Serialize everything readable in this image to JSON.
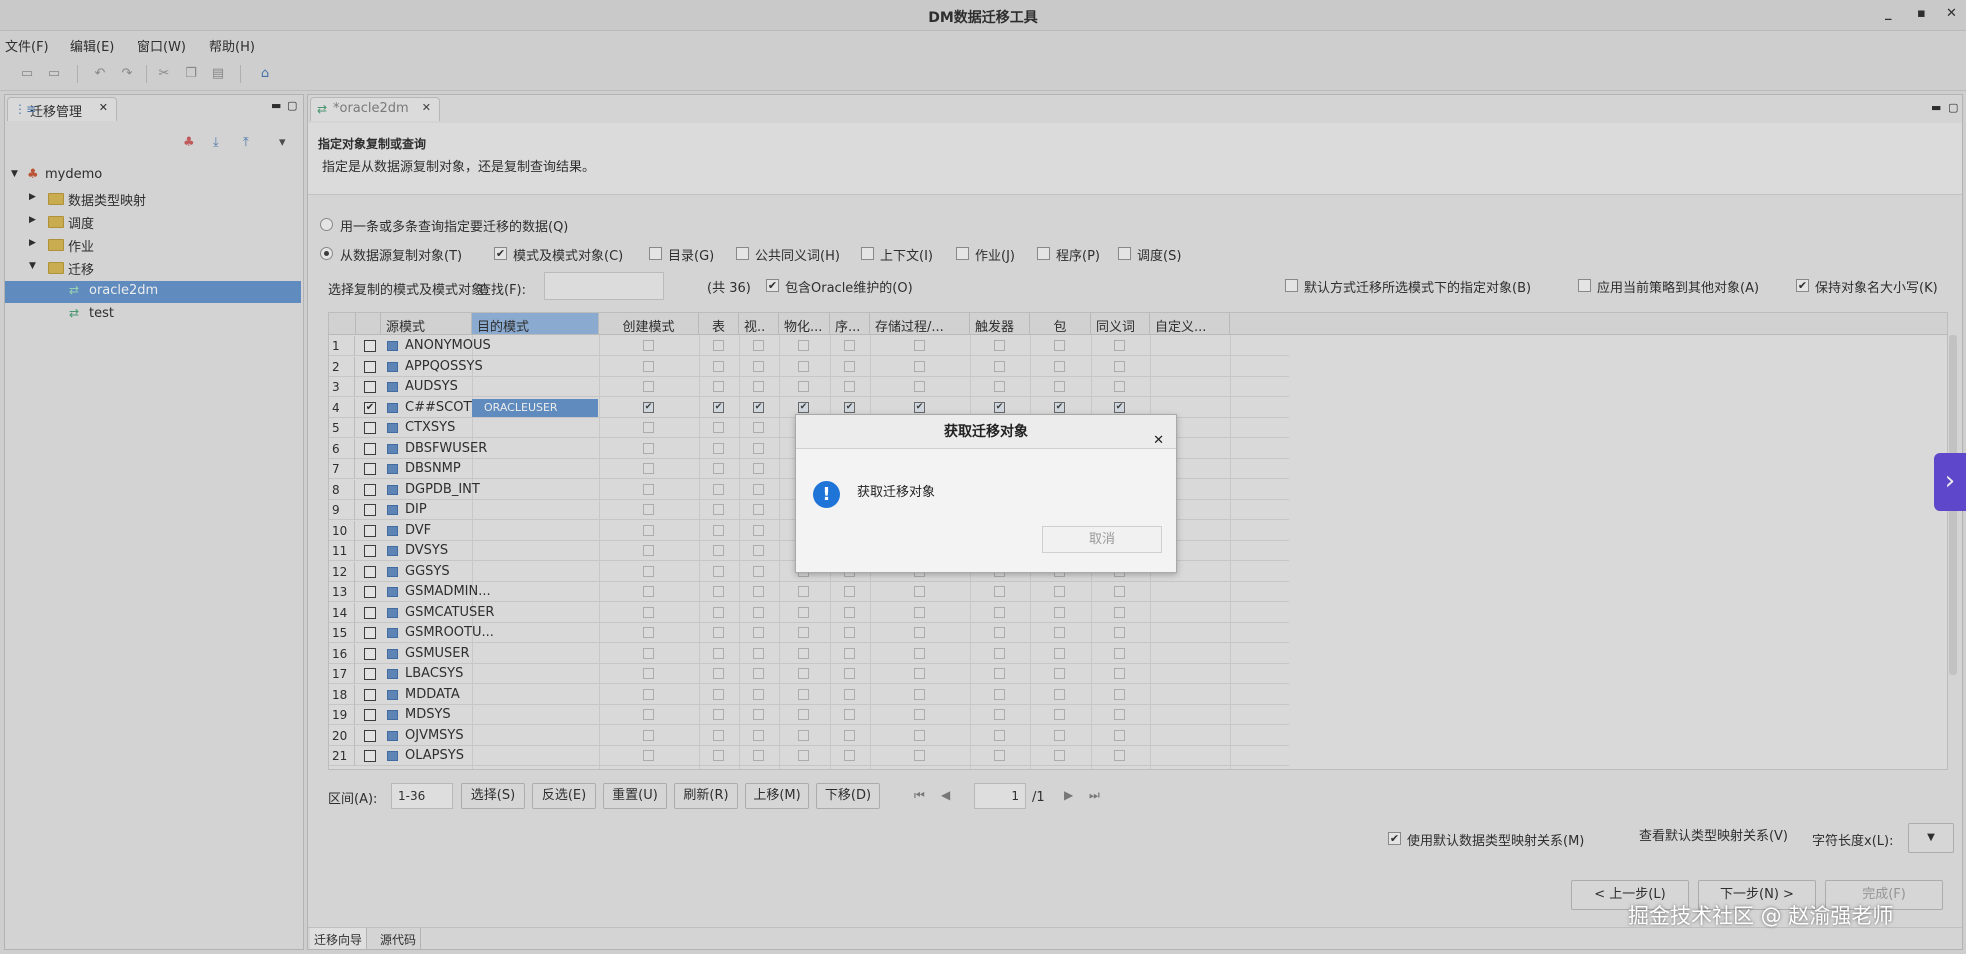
{
  "window": {
    "title": "DM数据迁移工具",
    "minimize": "▪",
    "maximize": "▪",
    "close": "✕"
  },
  "menu": [
    "文件(F)",
    "编辑(E)",
    "窗口(W)",
    "帮助(H)"
  ],
  "toolbar_icons": [
    "save-icon",
    "save-all-icon",
    "undo-icon",
    "redo-icon",
    "cut-icon",
    "copy-icon",
    "paste-icon",
    "home-icon"
  ],
  "left_panel": {
    "tab": "迁移管理",
    "tree": {
      "root": "mydemo",
      "children": [
        "数据类型映射",
        "调度",
        "作业",
        "迁移"
      ],
      "migrations": [
        "oracle2dm",
        "test"
      ],
      "selected": "oracle2dm"
    }
  },
  "editor": {
    "tab": "*oracle2dm",
    "heading": "指定对象复制或查询",
    "subheading": "指定是从数据源复制对象，还是复制查询结果。",
    "option_query": "用一条或多条查询指定要迁移的数据(Q)",
    "option_copy": "从数据源复制对象(T)",
    "copy_checks": [
      {
        "label": "模式及模式对象(C)",
        "checked": true
      },
      {
        "label": "目录(G)",
        "checked": false
      },
      {
        "label": "公共同义词(H)",
        "checked": false
      },
      {
        "label": "上下文(I)",
        "checked": false
      },
      {
        "label": "作业(J)",
        "checked": false
      },
      {
        "label": "程序(P)",
        "checked": false
      },
      {
        "label": "调度(S)",
        "checked": false
      }
    ],
    "select_label": "选择复制的模式及模式对象:",
    "search_label": "查找(F):",
    "count_text": "(共 36)",
    "include_oracle": "包含Oracle维护的(O)",
    "default_migrate": "默认方式迁移所选模式下的指定对象(B)",
    "apply_policy": "应用当前策略到其他对象(A)",
    "keep_case": "保持对象名大小写(K)",
    "columns": [
      "源模式",
      "目的模式",
      "创建模式",
      "表",
      "视..",
      "物化...",
      "序...",
      "存储过程/...",
      "触发器",
      "包",
      "同义词",
      "自定义..."
    ],
    "rows": [
      {
        "n": "1",
        "name": "ANONYMOUS"
      },
      {
        "n": "2",
        "name": "APPQOSSYS"
      },
      {
        "n": "3",
        "name": "AUDSYS"
      },
      {
        "n": "4",
        "name": "C##SCOTT",
        "checked": true,
        "dest": "ORACLEUSER"
      },
      {
        "n": "5",
        "name": "CTXSYS"
      },
      {
        "n": "6",
        "name": "DBSFWUSER"
      },
      {
        "n": "7",
        "name": "DBSNMP"
      },
      {
        "n": "8",
        "name": "DGPDB_INT"
      },
      {
        "n": "9",
        "name": "DIP"
      },
      {
        "n": "10",
        "name": "DVF"
      },
      {
        "n": "11",
        "name": "DVSYS"
      },
      {
        "n": "12",
        "name": "GGSYS"
      },
      {
        "n": "13",
        "name": "GSMADMIN..."
      },
      {
        "n": "14",
        "name": "GSMCATUSER"
      },
      {
        "n": "15",
        "name": "GSMROOTU..."
      },
      {
        "n": "16",
        "name": "GSMUSER"
      },
      {
        "n": "17",
        "name": "LBACSYS"
      },
      {
        "n": "18",
        "name": "MDDATA"
      },
      {
        "n": "19",
        "name": "MDSYS"
      },
      {
        "n": "20",
        "name": "OJVMSYS"
      },
      {
        "n": "21",
        "name": "OLAPSYS"
      }
    ],
    "pager": {
      "range_label": "区间(A):",
      "range_value": "1-36",
      "buttons": [
        "选择(S)",
        "反选(E)",
        "重置(U)",
        "刷新(R)",
        "上移(M)",
        "下移(D)"
      ],
      "page": "1",
      "total": "/1"
    },
    "type_mapping_check": "使用默认数据类型映射关系(M)",
    "view_mapping_button": "查看默认类型映射关系(V)",
    "char_len_label": "字符长度x(L):",
    "prev_button": "< 上一步(L)",
    "next_button": "下一步(N) >",
    "finish_button": "完成(F)",
    "bottom_tabs": [
      "迁移向导",
      "源代码"
    ]
  },
  "dialog": {
    "title": "获取迁移对象",
    "message": "获取迁移对象",
    "cancel": "取消"
  },
  "watermark": "掘金技术社区 @ 赵渝强老师"
}
